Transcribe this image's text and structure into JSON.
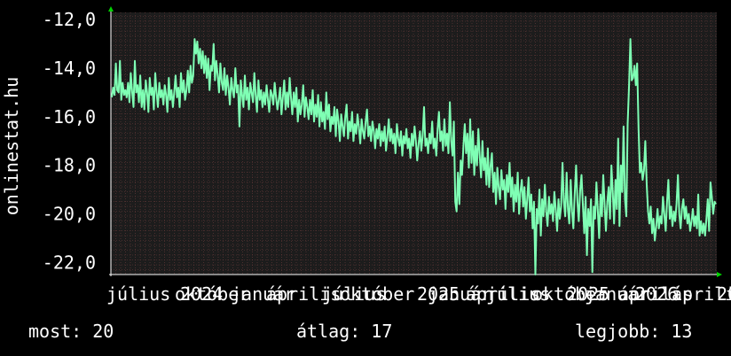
{
  "chart_data": {
    "type": "line",
    "ylabel": "onlinestat.hu",
    "ylim": [
      -22.5,
      -11.7
    ],
    "y_ticks": [
      {
        "value": -12,
        "label": "-12,0"
      },
      {
        "value": -14,
        "label": "-14,0"
      },
      {
        "value": -16,
        "label": "-16,0"
      },
      {
        "value": -18,
        "label": "-18,0"
      },
      {
        "value": -20,
        "label": "-20,0"
      },
      {
        "value": -22,
        "label": "-22,0"
      }
    ],
    "x_tick_labels": [
      "július",
      "október",
      "2024",
      "január",
      "április",
      "július",
      "október",
      "2025",
      "január",
      "április",
      "július",
      "október",
      "2025",
      "január",
      "április",
      "2026",
      "április",
      "20"
    ],
    "grid": true,
    "colors": {
      "background": "#000000",
      "plot_background": "#1c1c1c",
      "grid": "#6e3c3c",
      "line": "#7fffb4",
      "axis": "#ffffff",
      "arrow": "#00d200"
    },
    "series": [
      {
        "values": [
          -15.2,
          -14.8,
          -15.1,
          -13.8,
          -14.9,
          -15.0,
          -13.7,
          -15.3,
          -14.6,
          -15.1,
          -14.9,
          -15.2,
          -14.6,
          -15.4,
          -14.2,
          -15.0,
          -15.6,
          -13.7,
          -15.0,
          -14.7,
          -15.4,
          -14.3,
          -15.6,
          -14.9,
          -15.7,
          -14.5,
          -15.0,
          -15.8,
          -14.4,
          -15.1,
          -14.8,
          -15.7,
          -14.2,
          -15.0,
          -15.6,
          -14.6,
          -15.2,
          -14.9,
          -15.5,
          -14.7,
          -15.1,
          -15.8,
          -14.4,
          -15.3,
          -14.9,
          -15.6,
          -15.0,
          -14.3,
          -15.2,
          -14.8,
          -15.6,
          -14.2,
          -15.0,
          -14.5,
          -15.3,
          -14.9,
          -14.1,
          -15.0,
          -13.9,
          -14.6,
          -14.3,
          -12.8,
          -13.4,
          -12.9,
          -13.8,
          -13.2,
          -14.0,
          -13.3,
          -14.2,
          -13.5,
          -14.4,
          -13.6,
          -14.9,
          -13.9,
          -14.1,
          -13.0,
          -14.5,
          -13.7,
          -14.3,
          -15.0,
          -13.8,
          -14.6,
          -14.9,
          -14.0,
          -15.1,
          -14.3,
          -14.8,
          -15.5,
          -14.4,
          -14.9,
          -15.2,
          -14.0,
          -15.0,
          -14.7,
          -16.4,
          -14.5,
          -15.1,
          -15.6,
          -14.3,
          -15.3,
          -14.8,
          -15.7,
          -14.6,
          -15.0,
          -15.4,
          -14.2,
          -15.1,
          -15.8,
          -14.5,
          -15.3,
          -14.9,
          -15.6,
          -15.0,
          -15.5,
          -14.7,
          -15.3,
          -15.8,
          -14.9,
          -15.1,
          -15.5,
          -14.6,
          -15.2,
          -15.7,
          -15.3,
          -14.8,
          -15.9,
          -15.2,
          -14.5,
          -15.7,
          -15.0,
          -15.6,
          -14.4,
          -15.2,
          -15.9,
          -15.0,
          -15.6,
          -14.8,
          -16.2,
          -15.3,
          -15.9,
          -15.5,
          -14.7,
          -16.0,
          -15.2,
          -15.6,
          -16.1,
          -15.3,
          -15.9,
          -14.9,
          -16.2,
          -15.5,
          -16.0,
          -15.1,
          -16.4,
          -15.4,
          -16.2,
          -15.8,
          -16.5,
          -15.0,
          -16.1,
          -15.5,
          -16.6,
          -16.0,
          -16.3,
          -15.6,
          -16.8,
          -15.7,
          -16.2,
          -17.0,
          -15.9,
          -16.4,
          -16.8,
          -16.0,
          -15.5,
          -16.9,
          -16.2,
          -16.6,
          -15.8,
          -17.0,
          -16.3,
          -16.7,
          -15.9,
          -16.4,
          -17.1,
          -16.1,
          -16.6,
          -16.9,
          -16.2,
          -15.7,
          -16.8,
          -16.4,
          -17.0,
          -16.2,
          -16.6,
          -17.3,
          -16.5,
          -16.9,
          -16.3,
          -17.2,
          -16.6,
          -17.0,
          -16.4,
          -17.4,
          -16.8,
          -16.1,
          -17.0,
          -16.5,
          -17.1,
          -16.7,
          -17.5,
          -16.3,
          -16.9,
          -17.2,
          -16.6,
          -17.6,
          -16.8,
          -17.1,
          -16.5,
          -17.3,
          -16.9,
          -17.7,
          -16.7,
          -17.2,
          -16.4,
          -17.0,
          -17.8,
          -17.1,
          -16.6,
          -17.4,
          -16.8,
          -15.6,
          -17.2,
          -16.9,
          -17.5,
          -16.7,
          -17.1,
          -16.2,
          -17.3,
          -16.9,
          -17.6,
          -16.5,
          -15.8,
          -17.0,
          -16.6,
          -17.4,
          -16.1,
          -17.2,
          -16.7,
          -17.5,
          -15.4,
          -17.0,
          -17.6,
          -16.2,
          -19.5,
          -19.9,
          -18.3,
          -19.6,
          -17.8,
          -18.4,
          -17.2,
          -16.3,
          -17.5,
          -16.7,
          -18.1,
          -16.1,
          -17.9,
          -16.6,
          -18.4,
          -17.2,
          -18.0,
          -16.5,
          -17.6,
          -18.5,
          -17.0,
          -18.2,
          -17.7,
          -18.8,
          -17.3,
          -18.9,
          -18.0,
          -17.5,
          -19.1,
          -18.3,
          -19.6,
          -18.1,
          -18.9,
          -19.4,
          -18.2,
          -19.0,
          -18.6,
          -19.8,
          -18.4,
          -19.1,
          -17.9,
          -19.3,
          -18.5,
          -19.9,
          -18.8,
          -19.5,
          -18.3,
          -20.0,
          -19.1,
          -18.6,
          -19.7,
          -18.9,
          -20.2,
          -19.4,
          -18.5,
          -19.9,
          -19.2,
          -20.6,
          -19.5,
          -22.5,
          -19.8,
          -20.4,
          -19.0,
          -20.9,
          -19.4,
          -20.1,
          -18.8,
          -19.9,
          -20.5,
          -19.3,
          -20.0,
          -19.6,
          -20.3,
          -19.1,
          -19.8,
          -20.7,
          -19.4,
          -20.2,
          -19.7,
          -17.9,
          -19.5,
          -20.1,
          -18.3,
          -19.8,
          -20.4,
          -18.6,
          -19.9,
          -20.6,
          -19.2,
          -18.0,
          -19.5,
          -20.3,
          -19.0,
          -18.4,
          -19.6,
          -20.8,
          -19.3,
          -21.7,
          -19.8,
          -20.5,
          -19.4,
          -22.4,
          -19.7,
          -20.2,
          -18.7,
          -19.9,
          -21.0,
          -19.2,
          -20.1,
          -18.4,
          -19.6,
          -20.7,
          -19.5,
          -18.9,
          -20.2,
          -18.0,
          -19.1,
          -20.4,
          -18.6,
          -19.8,
          -16.9,
          -20.5,
          -18.0,
          -19.1,
          -16.4,
          -19.4,
          -20.1,
          -16.3,
          -14.7,
          -12.8,
          -14.5,
          -14.4,
          -13.9,
          -14.7,
          -13.8,
          -16.5,
          -18.3,
          -17.9,
          -18.6,
          -18.2,
          -17.0,
          -18.8,
          -19.9,
          -20.4,
          -19.7,
          -20.8,
          -20.2,
          -21.1,
          -20.5,
          -19.8,
          -20.6,
          -20.1,
          -20.4,
          -19.3,
          -20.0,
          -20.7,
          -19.5,
          -18.6,
          -20.2,
          -19.7,
          -20.5,
          -19.9,
          -20.3,
          -19.6,
          -18.4,
          -20.0,
          -20.6,
          -19.8,
          -19.4,
          -20.2,
          -19.7,
          -20.4,
          -20.0,
          -20.7,
          -20.3,
          -19.8,
          -20.5,
          -20.1,
          -20.6,
          -19.2,
          -20.9,
          -20.3,
          -20.8,
          -20.4,
          -20.9,
          -20.2,
          -19.4,
          -20.7,
          -18.7,
          -19.3,
          -20.0,
          -19.5,
          -19.6
        ]
      }
    ]
  },
  "stats": {
    "most": "most: 20",
    "atlag": "átlag: 17",
    "legjobb": "legjobb: 13"
  }
}
